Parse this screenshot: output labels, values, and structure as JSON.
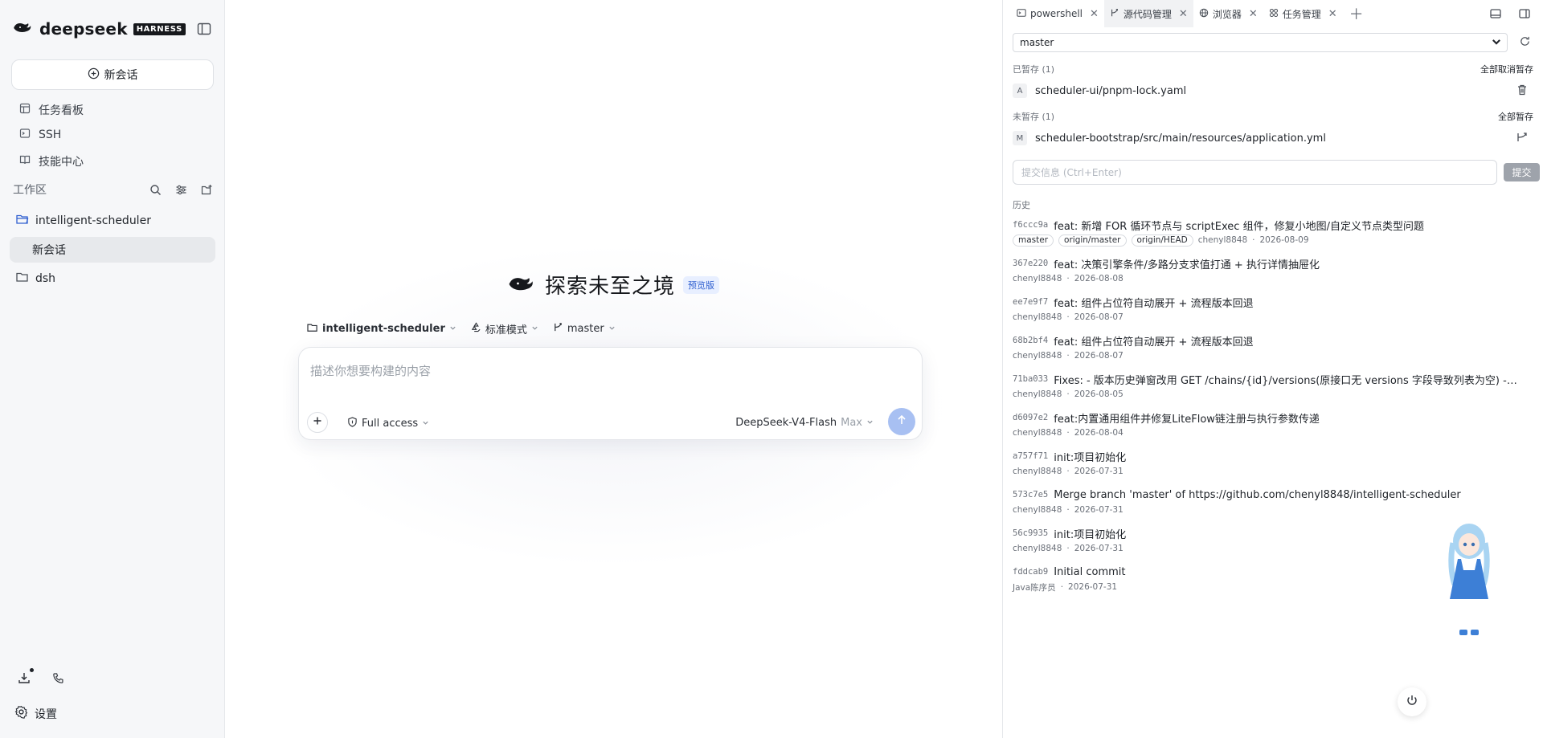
{
  "sidebar": {
    "brand_name": "deepseek",
    "brand_badge": "HARNESS",
    "new_chat_label": "新会话",
    "nav": [
      {
        "label": "任务看板",
        "icon": "board-icon"
      },
      {
        "label": "SSH",
        "icon": "terminal-icon"
      },
      {
        "label": "技能中心",
        "icon": "book-icon"
      }
    ],
    "workspace_title": "工作区",
    "projects": [
      {
        "label": "intelligent-scheduler",
        "session": "新会话"
      },
      {
        "label": "dsh"
      }
    ],
    "settings_label": "设置"
  },
  "main": {
    "hero_title": "探索未至之境",
    "hero_badge": "预览版",
    "chips": {
      "project": "intelligent-scheduler",
      "mode": "标准模式",
      "branch": "master"
    },
    "composer": {
      "placeholder": "描述你想要构建的内容",
      "access": "Full access",
      "model": "DeepSeek-V4-Flash",
      "effort": "Max"
    }
  },
  "panel": {
    "tabs": [
      {
        "label": "powershell",
        "active": false
      },
      {
        "label": "源代码管理",
        "active": true
      },
      {
        "label": "浏览器",
        "active": false
      },
      {
        "label": "任务管理",
        "active": false
      }
    ],
    "branch": "master",
    "staged": {
      "label": "已暂存 (1)",
      "action": "全部取消暂存",
      "files": [
        {
          "status": "A",
          "path": "scheduler-ui/pnpm-lock.yaml"
        }
      ]
    },
    "unstaged": {
      "label": "未暂存 (1)",
      "action": "全部暂存",
      "files": [
        {
          "status": "M",
          "path": "scheduler-bootstrap/src/main/resources/application.yml"
        }
      ]
    },
    "commit_placeholder": "提交信息 (Ctrl+Enter)",
    "commit_label": "提交",
    "history_title": "历史",
    "commits": [
      {
        "hash": "f6ccc9a",
        "message": "feat: 新增 FOR 循环节点与 scriptExec 组件，修复小地图/自定义节点类型问题",
        "refs": [
          "master",
          "origin/master",
          "origin/HEAD"
        ],
        "author": "chenyl8848",
        "date": "2026-08-09"
      },
      {
        "hash": "367e220",
        "message": "feat: 决策引擎条件/多路分支求值打通 + 执行详情抽屉化",
        "refs": [],
        "author": "chenyl8848",
        "date": "2026-08-08"
      },
      {
        "hash": "ee7e9f7",
        "message": "feat: 组件占位符自动展开 + 流程版本回退",
        "refs": [],
        "author": "chenyl8848",
        "date": "2026-08-07"
      },
      {
        "hash": "68b2bf4",
        "message": "feat: 组件占位符自动展开 + 流程版本回退",
        "refs": [],
        "author": "chenyl8848",
        "date": "2026-08-07"
      },
      {
        "hash": "71ba033",
        "message": "Fixes: - 版本历史弹窗改用 GET /chains/{id}/versions(原接口无 versions 字段导致列表为空) - 点...",
        "refs": [],
        "author": "chenyl8848",
        "date": "2026-08-05"
      },
      {
        "hash": "d6097e2",
        "message": "feat:内置通用组件并修复LiteFlow链注册与执行参数传递",
        "refs": [],
        "author": "chenyl8848",
        "date": "2026-08-04"
      },
      {
        "hash": "a757f71",
        "message": "init:项目初始化",
        "refs": [],
        "author": "chenyl8848",
        "date": "2026-07-31"
      },
      {
        "hash": "573c7e5",
        "message": "Merge branch 'master' of https://github.com/chenyl8848/intelligent-scheduler",
        "refs": [],
        "author": "chenyl8848",
        "date": "2026-07-31"
      },
      {
        "hash": "56c9935",
        "message": "init:项目初始化",
        "refs": [],
        "author": "chenyl8848",
        "date": "2026-07-31"
      },
      {
        "hash": "fddcab9",
        "message": "Initial commit",
        "refs": [],
        "author": "Java陈序员",
        "date": "2026-07-31"
      }
    ]
  },
  "colors": {
    "accent": "#3060d0",
    "send_button": "#a8c0f2",
    "sidebar_bg": "#f6f7f9",
    "active_session_bg": "#e7e9ec"
  }
}
